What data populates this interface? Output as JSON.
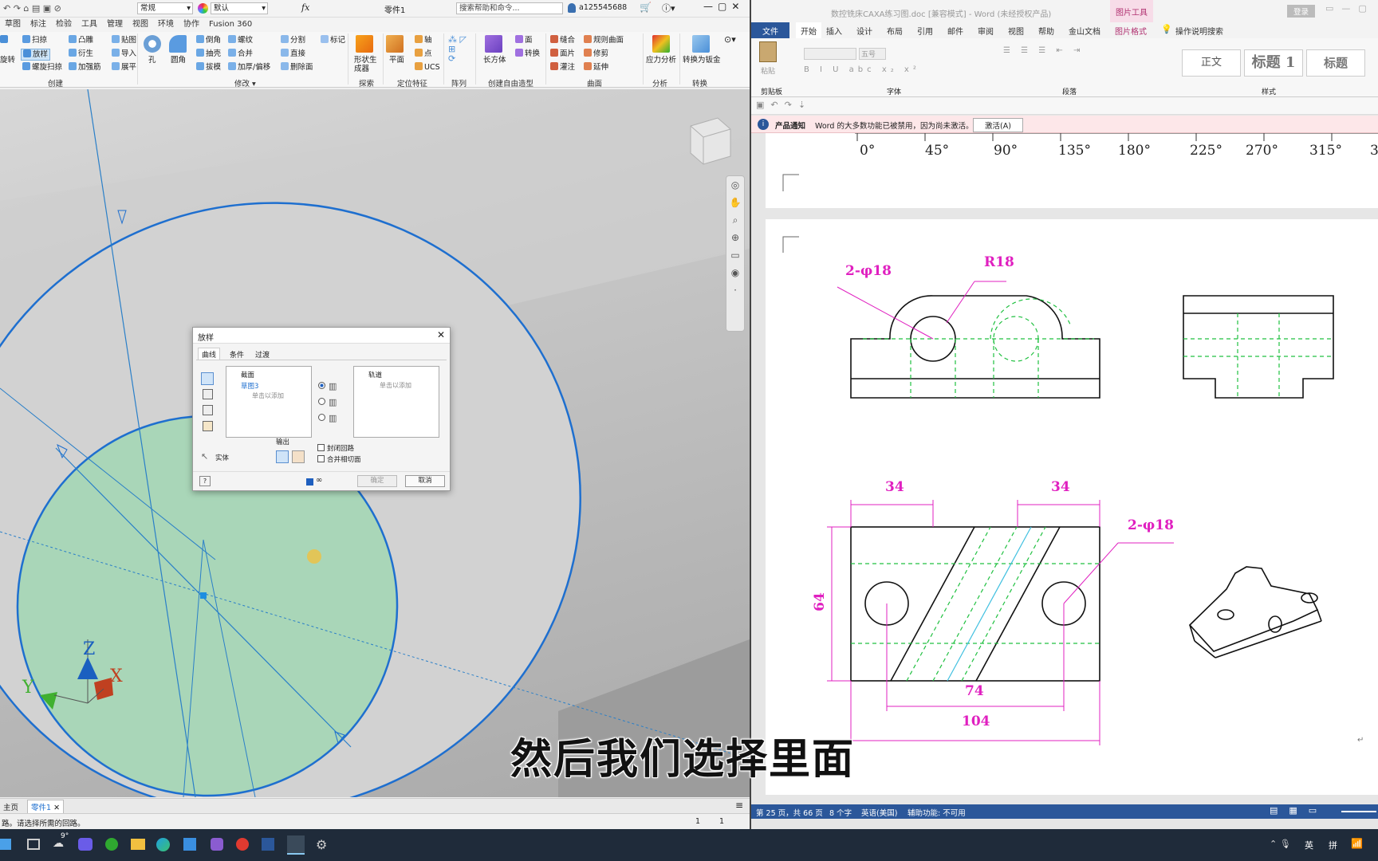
{
  "left_app": {
    "qat": {
      "style_combo": "常规",
      "color_combo": "默认",
      "doc_title": "零件1",
      "search_placeholder": "搜索帮助和命令...",
      "user": "a125545688",
      "fx": "fx"
    },
    "menu": [
      "草图",
      "标注",
      "检验",
      "工具",
      "管理",
      "视图",
      "环境",
      "协作",
      "Fusion 360"
    ],
    "ribbon": {
      "items": [
        "旋转",
        "扫掠",
        "放样",
        "螺旋扫掠",
        "凸雕",
        "衍生",
        "加强筋",
        "贴图",
        "导入",
        "展平",
        "孔",
        "圆角",
        "倒角",
        "抽壳",
        "拔模",
        "螺纹",
        "合并",
        "加厚/偏移",
        "分割",
        "直接",
        "删除面",
        "标记",
        "形状生成器",
        "平面",
        "轴",
        "点",
        "UCS",
        "长方体",
        "面",
        "转换",
        "缝合",
        "面片",
        "灌注",
        "规则曲面",
        "修剪",
        "延伸",
        "应力分析",
        "转换为钣金"
      ],
      "groups": [
        "创建",
        "修改 ▾",
        "探索",
        "定位特征",
        "阵列",
        "创建自由造型",
        "曲面",
        "分析",
        "转换"
      ]
    },
    "viewport": {
      "axis_x": "X",
      "axis_y": "Y",
      "axis_z": "Z"
    },
    "dialog": {
      "title": "放样",
      "tabs": [
        "曲线",
        "条件",
        "过渡"
      ],
      "sections_label": "截面",
      "section_item": "草图3",
      "click_to_add": "单击以添加",
      "rails_label": "轨道",
      "rails_click": "单击以添加",
      "output_label": "输出",
      "solid_label": "实体",
      "closed_loop": "封闭回路",
      "merge_tangent": "合并相切面",
      "ok": "确定",
      "cancel": "取消",
      "help": "?"
    },
    "tabs": [
      "主页",
      "零件1"
    ],
    "status_text": "路。请选择所需的回路。",
    "status_n1": "1",
    "status_n2": "1"
  },
  "word": {
    "title": "数控铣床CAXA练习图.doc [兼容模式] - Word (未经授权产品)",
    "tool_context": "图片工具",
    "login": "登录",
    "tabs": [
      "文件",
      "开始",
      "插入",
      "设计",
      "布局",
      "引用",
      "邮件",
      "审阅",
      "视图",
      "帮助",
      "金山文档",
      "图片格式",
      "操作说明搜索"
    ],
    "ribbon": {
      "paste": "粘贴",
      "clipboard": "剪贴板",
      "font": "字体",
      "paragraph": "段落",
      "styles_group": "样式",
      "font_size": "五号",
      "styles": [
        "正文",
        "标题 1",
        "标题"
      ]
    },
    "notice": {
      "label": "产品通知",
      "text": "Word 的大多数功能已被禁用，因为尚未激活。",
      "button": "激活(A)"
    },
    "angle_ticks": [
      "0°",
      "45°",
      "90°",
      "135°",
      "180°",
      "225°",
      "270°",
      "315°",
      "3"
    ],
    "drawing": {
      "r18": "R18",
      "hole_top": "2-φ18",
      "hole_side": "2-φ18",
      "d34a": "34",
      "d34b": "34",
      "d64": "64",
      "d74": "74",
      "d104": "104"
    },
    "status": {
      "page": "第 25 页，共 66 页",
      "words": "8 个字",
      "lang": "英语(美国)",
      "access": "辅助功能: 不可用"
    }
  },
  "taskbar": {
    "temp": "9°",
    "ime1": "英",
    "ime2": "拼"
  },
  "subtitle": "然后我们选择里面"
}
